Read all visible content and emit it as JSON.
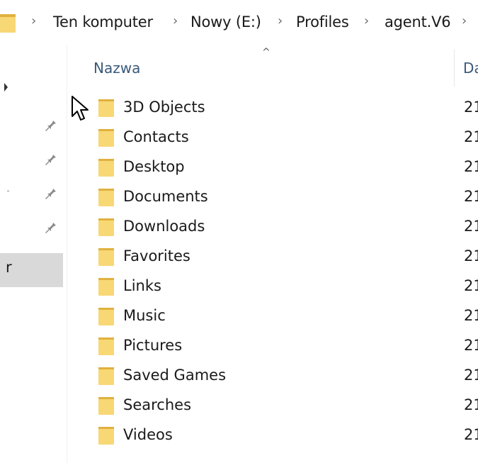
{
  "breadcrumb": {
    "items": [
      "Ten komputer",
      "Nowy (E:)",
      "Profiles",
      "agent.V6"
    ],
    "separator": ">"
  },
  "nav": {
    "selected_fragment": "r",
    "pin_icon": "pin-icon"
  },
  "columns": {
    "name": "Nazwa",
    "date_fragment": "Da"
  },
  "files": [
    {
      "name": "3D Objects",
      "date_fragment": "21"
    },
    {
      "name": "Contacts",
      "date_fragment": "21"
    },
    {
      "name": "Desktop",
      "date_fragment": "21"
    },
    {
      "name": "Documents",
      "date_fragment": "21"
    },
    {
      "name": "Downloads",
      "date_fragment": "21"
    },
    {
      "name": "Favorites",
      "date_fragment": "21"
    },
    {
      "name": "Links",
      "date_fragment": "21"
    },
    {
      "name": "Music",
      "date_fragment": "21"
    },
    {
      "name": "Pictures",
      "date_fragment": "21"
    },
    {
      "name": "Saved Games",
      "date_fragment": "21"
    },
    {
      "name": "Searches",
      "date_fragment": "21"
    },
    {
      "name": "Videos",
      "date_fragment": "21"
    }
  ],
  "colors": {
    "folder": "#f8d775",
    "folder_dark": "#e0b13f",
    "header_text": "#3b5a7a",
    "nav_selected": "#d9d9d9"
  }
}
